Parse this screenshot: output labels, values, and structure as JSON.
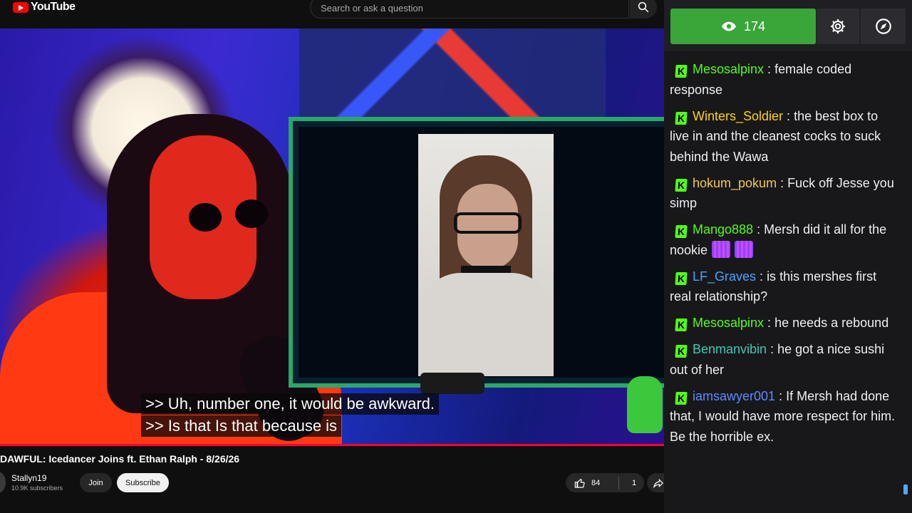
{
  "header": {
    "logo_text": "YouTube",
    "search_placeholder": "Search or ask a question"
  },
  "video": {
    "captions": [
      ">> Uh, number one, it would be awkward.",
      ">> Is that Is that because is"
    ],
    "title": "DAWFUL: Icedancer Joins ft. Ethan Ralph - 8/26/26",
    "channel_name": "Stallyn19",
    "subscribers": "10.9K subscribers",
    "join_label": "Join",
    "subscribe_label": "Subscribe",
    "likes": "84",
    "dislikes": "1"
  },
  "chat": {
    "viewer_count": "174",
    "messages": [
      {
        "user": "Benmanvibin",
        "sep": " : ",
        "text": "",
        "color": "#3fc8b4",
        "emote": "small",
        "partial": true
      },
      {
        "user": "Mesosalpinx",
        "sep": " : ",
        "text": "female coded response",
        "color": "#53fc18"
      },
      {
        "user": "Winters_Soldier",
        "sep": " : ",
        "text": "the best box to live in and the cleanest cocks to suck behind the Wawa",
        "color": "#ffd400"
      },
      {
        "user": "hokum_pokum",
        "sep": " : ",
        "text": "Fuck off Jesse you simp",
        "color": "#f2c94c"
      },
      {
        "user": "Mango888",
        "sep": " : ",
        "text": "Mersh did it all for the nookie",
        "color": "#53fc18",
        "emote": "double"
      },
      {
        "user": "LF_Graves",
        "sep": " : ",
        "text": "is this mershes first real relationship?",
        "color": "#4aa3ff"
      },
      {
        "user": "Mesosalpinx",
        "sep": " : ",
        "text": "he needs a rebound",
        "color": "#53fc18"
      },
      {
        "user": "Benmanvibin",
        "sep": " : ",
        "text": "he got a nice sushi out of her",
        "color": "#3fc8b4"
      },
      {
        "user": "iamsawyer001",
        "sep": " : ",
        "text": "If Mersh had done that, I would have more respect for him. Be the horrible ex.",
        "color": "#5b8cff"
      }
    ]
  },
  "colors": {
    "viewer_bg": "#3aa63a",
    "kick_badge": "#53fc18",
    "progress": "#ff0033"
  }
}
